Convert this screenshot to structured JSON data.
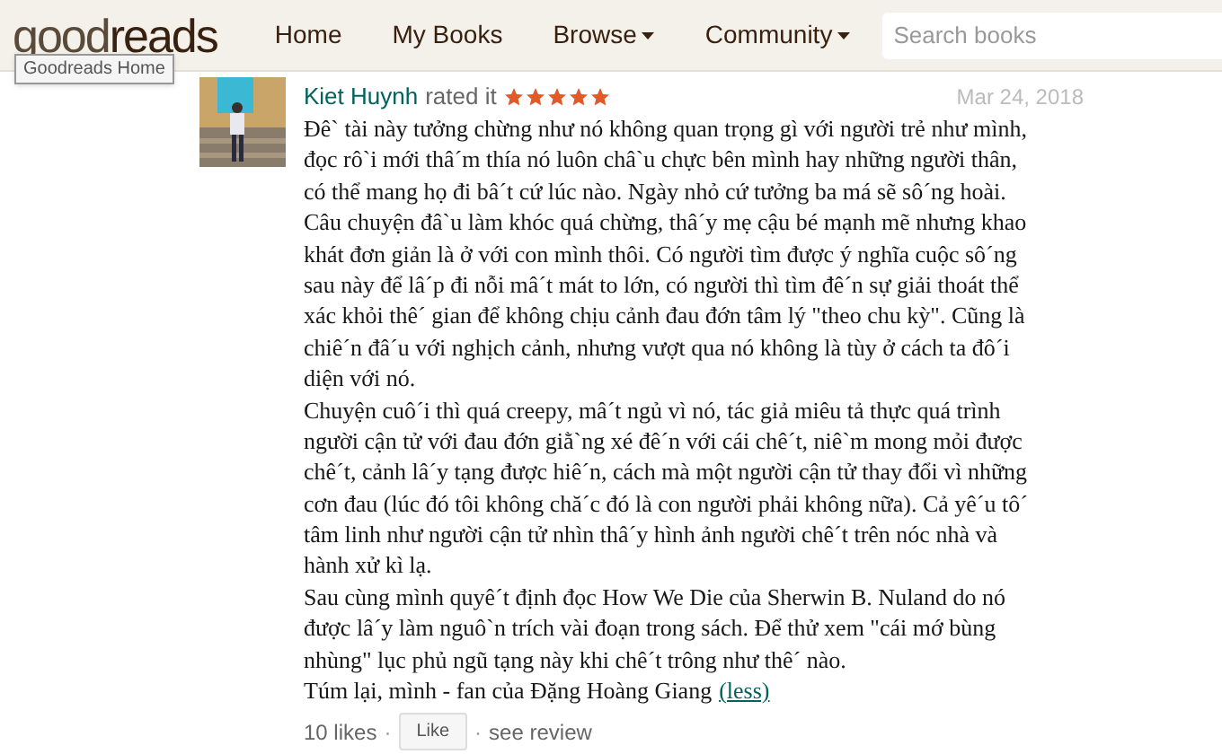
{
  "header": {
    "logo": {
      "light": "good",
      "dark": "reads"
    },
    "tooltip": "Goodreads Home",
    "nav": [
      {
        "label": "Home",
        "caret": false
      },
      {
        "label": "My Books",
        "caret": false
      },
      {
        "label": "Browse",
        "caret": true
      },
      {
        "label": "Community",
        "caret": true
      }
    ],
    "search": {
      "placeholder": "Search books"
    }
  },
  "review": {
    "user": "Kiet Huynh",
    "action": "rated it",
    "stars": 5,
    "date": "Mar 24, 2018",
    "paragraphs": [
      [
        "Đê` tài này tưởng chừng như nó không quan trọng gì với người trẻ như mình,",
        "đọc rô`i mới thâ´m thía nó luôn châ`u chực bên mình hay những người thân,",
        "có thể mang họ đi bâ´t cứ lúc nào. Ngày nhỏ cứ tưởng ba má sẽ sô´ng hoài."
      ],
      [
        "Câu chuyện đâ`u làm khóc quá chừng, thâ´y mẹ cậu bé mạnh mẽ nhưng khao",
        "khát đơn giản là ở với con mình thôi. Có người tìm được ý nghĩa cuộc sô´ng",
        "sau này để lâ´p đi nỗi mâ´t mát to lớn, có người thì tìm đê´n sự giải thoát thể",
        "xác khỏi thê´ gian để không chịu cảnh đau đớn tâm lý \"theo chu kỳ\". Cũng là",
        "chiê´n đâ´u với nghịch cảnh, nhưng vượt qua nó không là tùy ở cách ta đô´i",
        "diện với nó."
      ],
      [
        "Chuyện cuô´i thì quá creepy, mâ´t ngủ vì nó, tác giả miêu tả thực quá trình",
        "người cận tử với đau đớn giằ`ng xé đê´n với cái chê´t, niê`m mong mỏi được",
        "chê´t, cảnh lâ´y tạng được hiê´n, cách mà một người cận tử thay đổi vì những",
        "cơn đau (lúc đó tôi không chă´c đó là con người phải không nữa). Cả yê´u tô´",
        "tâm linh như người cận tử nhìn thâ´y hình ảnh người chê´t trên nóc nhà và",
        "hành xử kì lạ."
      ],
      [
        "Sau cùng mình quyê´t định đọc How We Die của Sherwin B. Nuland do nó",
        "được lâ´y làm nguô`n trích vài đoạn trong sách. Để thử xem \"cái mớ bùng",
        "nhùng\" lục phủ ngũ tạng này khi chê´t trông như thê´ nào."
      ]
    ],
    "closing": "Túm lại, mình - fan của Đặng Hoàng Giang",
    "less": "(less)",
    "likes": "10 likes",
    "separators": [
      "·",
      "·"
    ],
    "like_button": "Like",
    "see_review": "see review"
  }
}
